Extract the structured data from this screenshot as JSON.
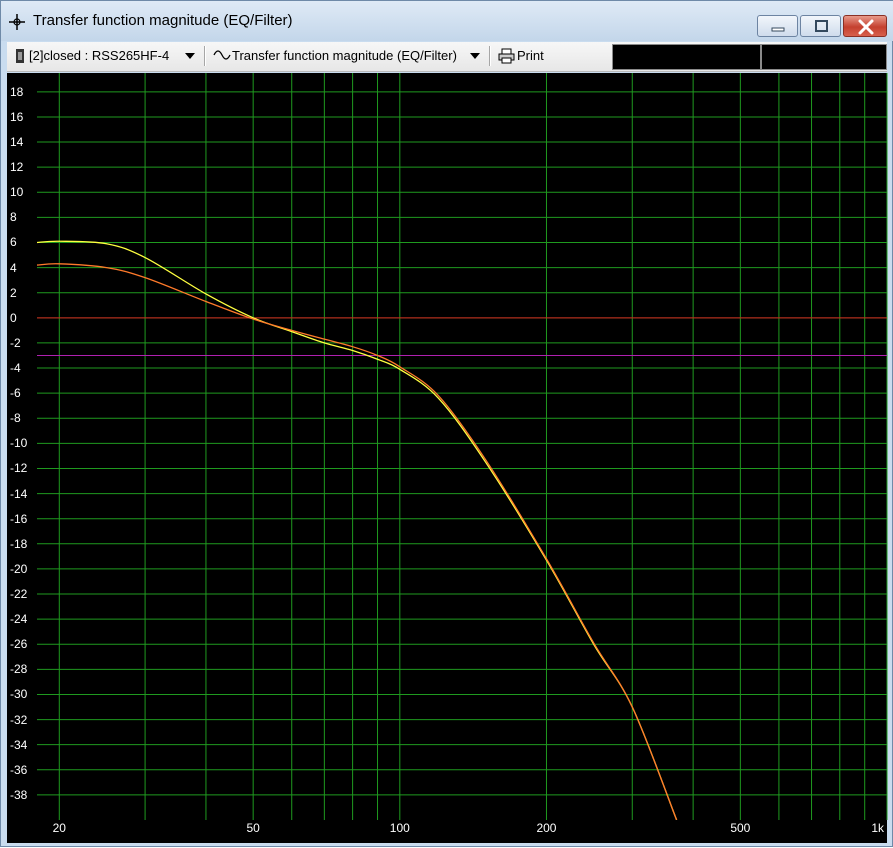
{
  "window": {
    "title": "Transfer function magnitude (EQ/Filter)"
  },
  "toolbar": {
    "driver_selector": "[2]closed : RSS265HF-4",
    "view_selector": "Transfer function magnitude (EQ/Filter)",
    "print_label": "Print"
  },
  "colors": {
    "plot_background": "#000000",
    "grid": "#1f9a1f",
    "curve_yellow": "#ffff40",
    "curve_orange": "#ff7a2a",
    "reference_0db": "#d42020",
    "reference_minus3db": "#b020b0"
  },
  "chart_data": {
    "type": "line",
    "title": "",
    "xlabel": "",
    "ylabel": "",
    "x_scale": "log",
    "xlim": [
      18,
      1000
    ],
    "ylim": [
      -40,
      19.5
    ],
    "grid": true,
    "x_tick_labels": [
      {
        "value": 20,
        "label": "20"
      },
      {
        "value": 50,
        "label": "50"
      },
      {
        "value": 100,
        "label": "100"
      },
      {
        "value": 200,
        "label": "200"
      },
      {
        "value": 500,
        "label": "500"
      },
      {
        "value": 1000,
        "label": "1k"
      }
    ],
    "x_grid_values": [
      20,
      30,
      40,
      50,
      60,
      70,
      80,
      90,
      100,
      200,
      300,
      400,
      500,
      600,
      700,
      800,
      900,
      1000
    ],
    "y_ticks": [
      18,
      16,
      14,
      12,
      10,
      8,
      6,
      4,
      2,
      0,
      -2,
      -4,
      -6,
      -8,
      -10,
      -12,
      -14,
      -16,
      -18,
      -20,
      -22,
      -24,
      -26,
      -28,
      -30,
      -32,
      -34,
      -36,
      -38
    ],
    "reference_lines": [
      {
        "y": 0,
        "color": "#d42020"
      },
      {
        "y": -3,
        "color": "#b020b0"
      }
    ],
    "series": [
      {
        "color": "#ffff40",
        "x": [
          18,
          20,
          25,
          30,
          40,
          50,
          60,
          70,
          80,
          90,
          100,
          120,
          150,
          200,
          250,
          300,
          370
        ],
        "y": [
          6.0,
          6.1,
          5.9,
          4.8,
          1.9,
          0.0,
          -1.1,
          -2.0,
          -2.6,
          -3.3,
          -4.1,
          -6.4,
          -11.5,
          -19.3,
          -26.0,
          -31.0,
          -40.0
        ]
      },
      {
        "color": "#ff7a2a",
        "x": [
          18,
          20,
          25,
          30,
          40,
          50,
          60,
          70,
          80,
          90,
          100,
          120,
          150,
          200,
          250,
          300,
          370
        ],
        "y": [
          4.2,
          4.3,
          4.0,
          3.2,
          1.3,
          -0.1,
          -1.0,
          -1.7,
          -2.3,
          -3.0,
          -3.9,
          -6.2,
          -11.3,
          -19.2,
          -25.9,
          -31.0,
          -40.0
        ]
      }
    ]
  }
}
